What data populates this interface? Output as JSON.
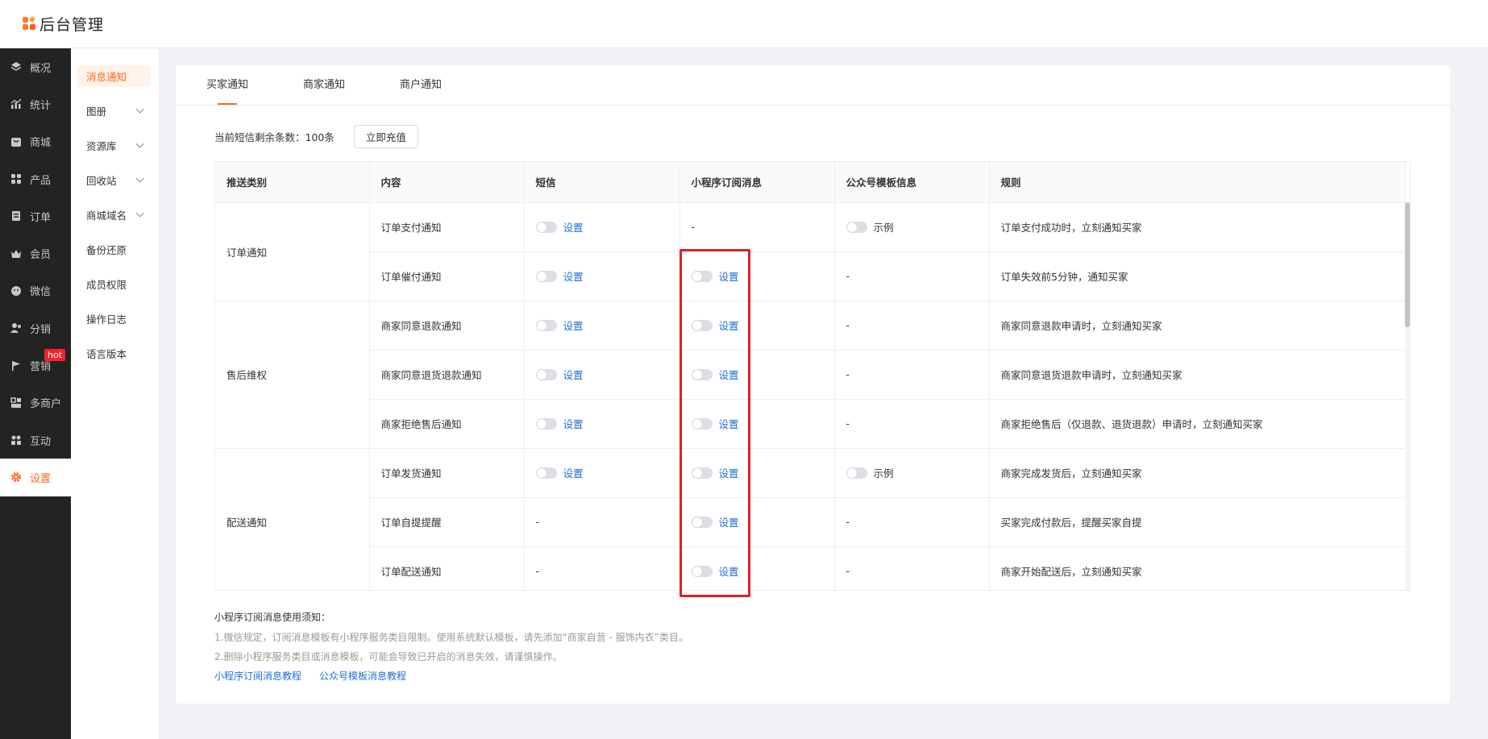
{
  "app": {
    "title": "后台管理"
  },
  "nav": {
    "items": [
      {
        "label": "概况",
        "icon": "layers-icon"
      },
      {
        "label": "统计",
        "icon": "chart-icon"
      },
      {
        "label": "商城",
        "icon": "shop-icon"
      },
      {
        "label": "产品",
        "icon": "grid-icon"
      },
      {
        "label": "订单",
        "icon": "order-icon"
      },
      {
        "label": "会员",
        "icon": "crown-icon"
      },
      {
        "label": "微信",
        "icon": "wechat-icon"
      },
      {
        "label": "分销",
        "icon": "users-icon"
      },
      {
        "label": "营销",
        "icon": "flag-icon",
        "badge": "hot"
      },
      {
        "label": "多商户",
        "icon": "store-icon"
      },
      {
        "label": "互动",
        "icon": "interact-icon"
      },
      {
        "label": "设置",
        "icon": "gear-icon",
        "active": true
      }
    ]
  },
  "subnav": {
    "items": [
      {
        "label": "消息通知",
        "active": true
      },
      {
        "label": "图册",
        "expandable": true
      },
      {
        "label": "资源库",
        "expandable": true
      },
      {
        "label": "回收站",
        "expandable": true
      },
      {
        "label": "商城域名",
        "expandable": true
      },
      {
        "label": "备份还原"
      },
      {
        "label": "成员权限"
      },
      {
        "label": "操作日志"
      },
      {
        "label": "语言版本"
      }
    ]
  },
  "tabs": [
    "买家通知",
    "商家通知",
    "商户通知"
  ],
  "quota": {
    "text": "当前短信剩余条数：100条",
    "button": "立即充值"
  },
  "table": {
    "headers": [
      "推送类别",
      "内容",
      "短信",
      "小程序订阅消息",
      "公众号模板信息",
      "规则"
    ],
    "groups": [
      {
        "category": "订单通知",
        "rows": [
          {
            "content": "订单支付通知",
            "sms": "设置",
            "mini": "-",
            "mp": "示例",
            "rule": "订单支付成功时，立刻通知买家"
          },
          {
            "content": "订单催付通知",
            "sms": "设置",
            "mini": "设置",
            "mp": "-",
            "rule": "订单失效前5分钟，通知买家"
          }
        ]
      },
      {
        "category": "售后维权",
        "rows": [
          {
            "content": "商家同意退款通知",
            "sms": "设置",
            "mini": "设置",
            "mp": "-",
            "rule": "商家同意退款申请时，立刻通知买家"
          },
          {
            "content": "商家同意退货退款通知",
            "sms": "设置",
            "mini": "设置",
            "mp": "-",
            "rule": "商家同意退货退款申请时，立刻通知买家"
          },
          {
            "content": "商家拒绝售后通知",
            "sms": "设置",
            "mini": "设置",
            "mp": "-",
            "rule": "商家拒绝售后（仅退款、退货退款）申请时，立刻通知买家"
          }
        ]
      },
      {
        "category": "配送通知",
        "rows": [
          {
            "content": "订单发货通知",
            "sms": "设置",
            "mini": "设置",
            "mp": "示例",
            "rule": "商家完成发货后，立刻通知买家"
          },
          {
            "content": "订单自提提醒",
            "sms": "-",
            "mini": "设置",
            "mp": "-",
            "rule": "买家完成付款后，提醒买家自提"
          },
          {
            "content": "订单配送通知",
            "sms": "-",
            "mini": "设置",
            "mp": "-",
            "rule": "商家开始配送后，立刻通知买家"
          }
        ]
      }
    ]
  },
  "notes": {
    "title": "小程序订阅消息使用须知：",
    "lines": [
      "1.微信规定，订阅消息模板有小程序服务类目限制。使用系统默认模板，请先添加“商家自营 - 服饰内衣”类目。",
      "2.删除小程序服务类目或消息模板，可能会导致已开启的消息失效，请谨慎操作。"
    ],
    "links": [
      "小程序订阅消息教程",
      "公众号模板消息教程"
    ]
  },
  "colors": {
    "accent": "#ff6a1a",
    "link": "#1e6fd6",
    "highlight": "#e0202a",
    "nav_bg": "#232323"
  }
}
